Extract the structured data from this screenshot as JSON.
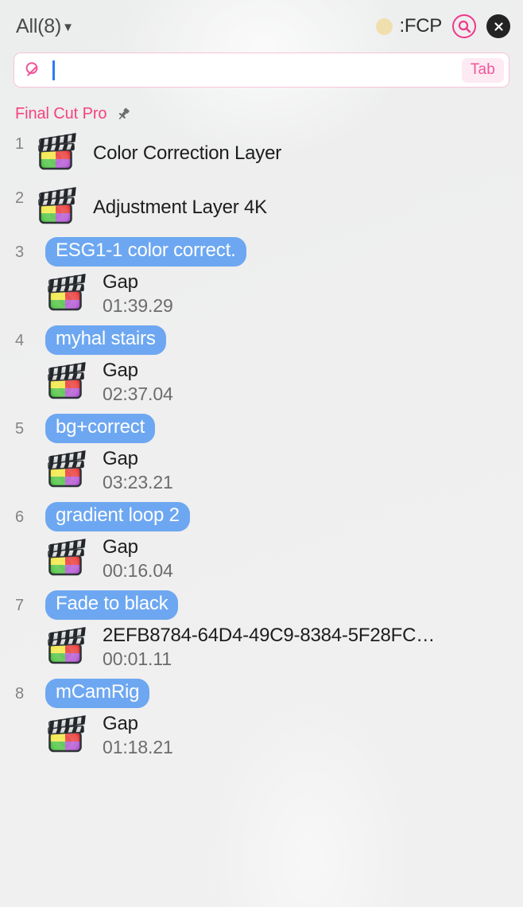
{
  "header": {
    "filter_label": "All(8)",
    "filter_caret": "▼",
    "app_tag": ":FCP",
    "dot_color": "#f0dfae",
    "search_icon": "search-icon",
    "close_icon": "close-icon"
  },
  "search": {
    "value": "",
    "placeholder": "",
    "hint_key": "Tab",
    "accent": "#f0378a",
    "caret_color": "#2d7df6"
  },
  "group": {
    "title": "Final Cut Pro",
    "title_color": "#f4437f",
    "pin_icon": "pin-icon"
  },
  "list": {
    "badge_color": "#6da7f1",
    "items": [
      {
        "index": "1",
        "style": "plain",
        "icon": "final-cut-pro-icon",
        "title": "Color Correction Layer"
      },
      {
        "index": "2",
        "style": "plain",
        "icon": "final-cut-pro-icon",
        "title": "Adjustment Layer 4K"
      },
      {
        "index": "3",
        "style": "badge",
        "badge": "ESG1-1 color correct.",
        "icon": "final-cut-pro-icon",
        "sub_title": "Gap",
        "sub_time": "01:39.29"
      },
      {
        "index": "4",
        "style": "badge",
        "badge": "myhal stairs",
        "icon": "final-cut-pro-icon",
        "sub_title": "Gap",
        "sub_time": "02:37.04"
      },
      {
        "index": "5",
        "style": "badge",
        "badge": "bg+correct",
        "icon": "final-cut-pro-icon",
        "sub_title": "Gap",
        "sub_time": "03:23.21"
      },
      {
        "index": "6",
        "style": "badge",
        "badge": "gradient loop 2",
        "icon": "final-cut-pro-icon",
        "sub_title": "Gap",
        "sub_time": "00:16.04"
      },
      {
        "index": "7",
        "style": "badge",
        "badge": "Fade to black",
        "icon": "final-cut-pro-icon",
        "sub_title": "2EFB8784-64D4-49C9-8384-5F28FC…",
        "sub_time": "00:01.11"
      },
      {
        "index": "8",
        "style": "badge",
        "badge": "mCamRig",
        "icon": "final-cut-pro-icon",
        "sub_title": "Gap",
        "sub_time": "01:18.21"
      }
    ]
  }
}
